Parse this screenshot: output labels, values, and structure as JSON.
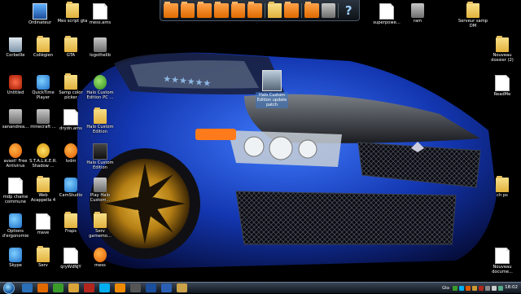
{
  "desktop": {
    "icons": [
      {
        "label": "Ordinateur",
        "kind": "computer",
        "icon": "computer-icon"
      },
      {
        "label": "Mes script gta",
        "kind": "folder",
        "icon": "folder-icon"
      },
      {
        "label": "mess.ams",
        "kind": "doc",
        "icon": "file-icon"
      },
      {
        "label": "Corbeille",
        "kind": "bin",
        "icon": "recycle-bin-icon"
      },
      {
        "label": "Collégien",
        "kind": "folder",
        "icon": "folder-icon"
      },
      {
        "label": "GTA",
        "kind": "folder",
        "icon": "folder-icon"
      },
      {
        "label": "logothelib",
        "kind": "app-gray",
        "icon": "image-file-icon"
      },
      {
        "label": "Untitled",
        "kind": "app-red",
        "icon": "pdf-icon"
      },
      {
        "label": "QuickTime Player",
        "kind": "app-blue",
        "icon": "quicktime-icon"
      },
      {
        "label": "Samp color picker",
        "kind": "folder",
        "icon": "folder-icon"
      },
      {
        "label": "Halo Custom Edition PC ...",
        "kind": "app-green",
        "icon": "torrent-icon"
      },
      {
        "label": "sanandrea...",
        "kind": "app-gray",
        "icon": "file-icon"
      },
      {
        "label": "minecraft ...",
        "kind": "app-gray",
        "icon": "file-icon"
      },
      {
        "label": "drydn.ams",
        "kind": "doc",
        "icon": "file-icon"
      },
      {
        "label": "Halo Custom Edition",
        "kind": "folder",
        "icon": "folder-icon"
      },
      {
        "label": "avast! Free Antivirus",
        "kind": "app-orange",
        "icon": "avast-icon"
      },
      {
        "label": "S.T.A.L.K.E.R. Shadow ...",
        "kind": "app-yellow",
        "icon": "stalker-icon"
      },
      {
        "label": "lvdm",
        "kind": "app-orange",
        "icon": "firefox-icon"
      },
      {
        "label": "Halo Custom Edition",
        "kind": "app-dark",
        "icon": "halo-icon"
      },
      {
        "label": "mdp chaine commune",
        "kind": "doc",
        "icon": "text-file-icon"
      },
      {
        "label": "Web Acappella 4",
        "kind": "folder",
        "icon": "folder-icon"
      },
      {
        "label": "CamStudio",
        "kind": "app-blue",
        "icon": "camstudio-icon"
      },
      {
        "label": "Play Halo Custom...",
        "kind": "app-gray",
        "icon": "halo-icon"
      },
      {
        "label": "Options d'ergonomie",
        "kind": "app-blue",
        "icon": "ease-of-access-icon"
      },
      {
        "label": "mave",
        "kind": "doc",
        "icon": "file-icon"
      },
      {
        "label": "Fraps",
        "kind": "folder",
        "icon": "folder-icon"
      },
      {
        "label": "Serv gamemo...",
        "kind": "folder",
        "icon": "folder-icon"
      },
      {
        "label": "Skype",
        "kind": "app-blue",
        "icon": "skype-icon"
      },
      {
        "label": "Serv",
        "kind": "folder",
        "icon": "folder-icon"
      },
      {
        "label": "qryWdNjY",
        "kind": "doc",
        "icon": "file-icon"
      },
      {
        "label": "mess",
        "kind": "app-orange",
        "icon": "firefox-icon"
      },
      {
        "label": "superpowe...",
        "kind": "doc",
        "icon": "file-icon"
      },
      {
        "label": "ram",
        "kind": "app-gray",
        "icon": "ram-icon"
      },
      {
        "label": "Serveur samp DM",
        "kind": "folder",
        "icon": "folder-icon"
      },
      {
        "label": "Nouveau dossier (2)",
        "kind": "folder",
        "icon": "folder-icon"
      },
      {
        "label": "ReadMe",
        "kind": "doc",
        "icon": "text-file-icon"
      },
      {
        "label": "ch ps",
        "kind": "folder",
        "icon": "folder-icon"
      },
      {
        "label": "Nouveau docume...",
        "kind": "doc",
        "icon": "text-file-icon"
      }
    ],
    "center_icon": {
      "label": "Halo Custom Edition update patch",
      "icon": "halo-update-icon"
    }
  },
  "toolbar": {
    "buttons": [
      {
        "icon": "folder-icon"
      },
      {
        "icon": "folder-icon"
      },
      {
        "icon": "folder-icon"
      },
      {
        "icon": "folder-icon"
      },
      {
        "icon": "folder-icon"
      },
      {
        "icon": "folder-icon"
      },
      {
        "icon": "folder-icon"
      },
      {
        "icon": "folder-icon"
      },
      {
        "icon": "folder-icon"
      }
    ],
    "help_label": "?"
  },
  "taskbar": {
    "items": [
      {
        "icon": "explorer-icon",
        "color": "#2a6fb8"
      },
      {
        "icon": "firefox-icon",
        "color": "#e06a00"
      },
      {
        "icon": "utorrent-icon",
        "color": "#3a9b2a"
      },
      {
        "icon": "folder-icon",
        "color": "#d9a53a"
      },
      {
        "icon": "filezilla-icon",
        "color": "#b3261e"
      },
      {
        "icon": "skype-icon",
        "color": "#00aff0"
      },
      {
        "icon": "vlc-icon",
        "color": "#f08a00"
      },
      {
        "icon": "halo-icon",
        "color": "#555555"
      },
      {
        "icon": "samp-icon",
        "color": "#1b4e9b"
      },
      {
        "icon": "word-icon",
        "color": "#2b5fb3"
      },
      {
        "icon": "paint-icon",
        "color": "#c9a24a"
      }
    ],
    "tray_label": "Gta",
    "clock": "18:02"
  }
}
